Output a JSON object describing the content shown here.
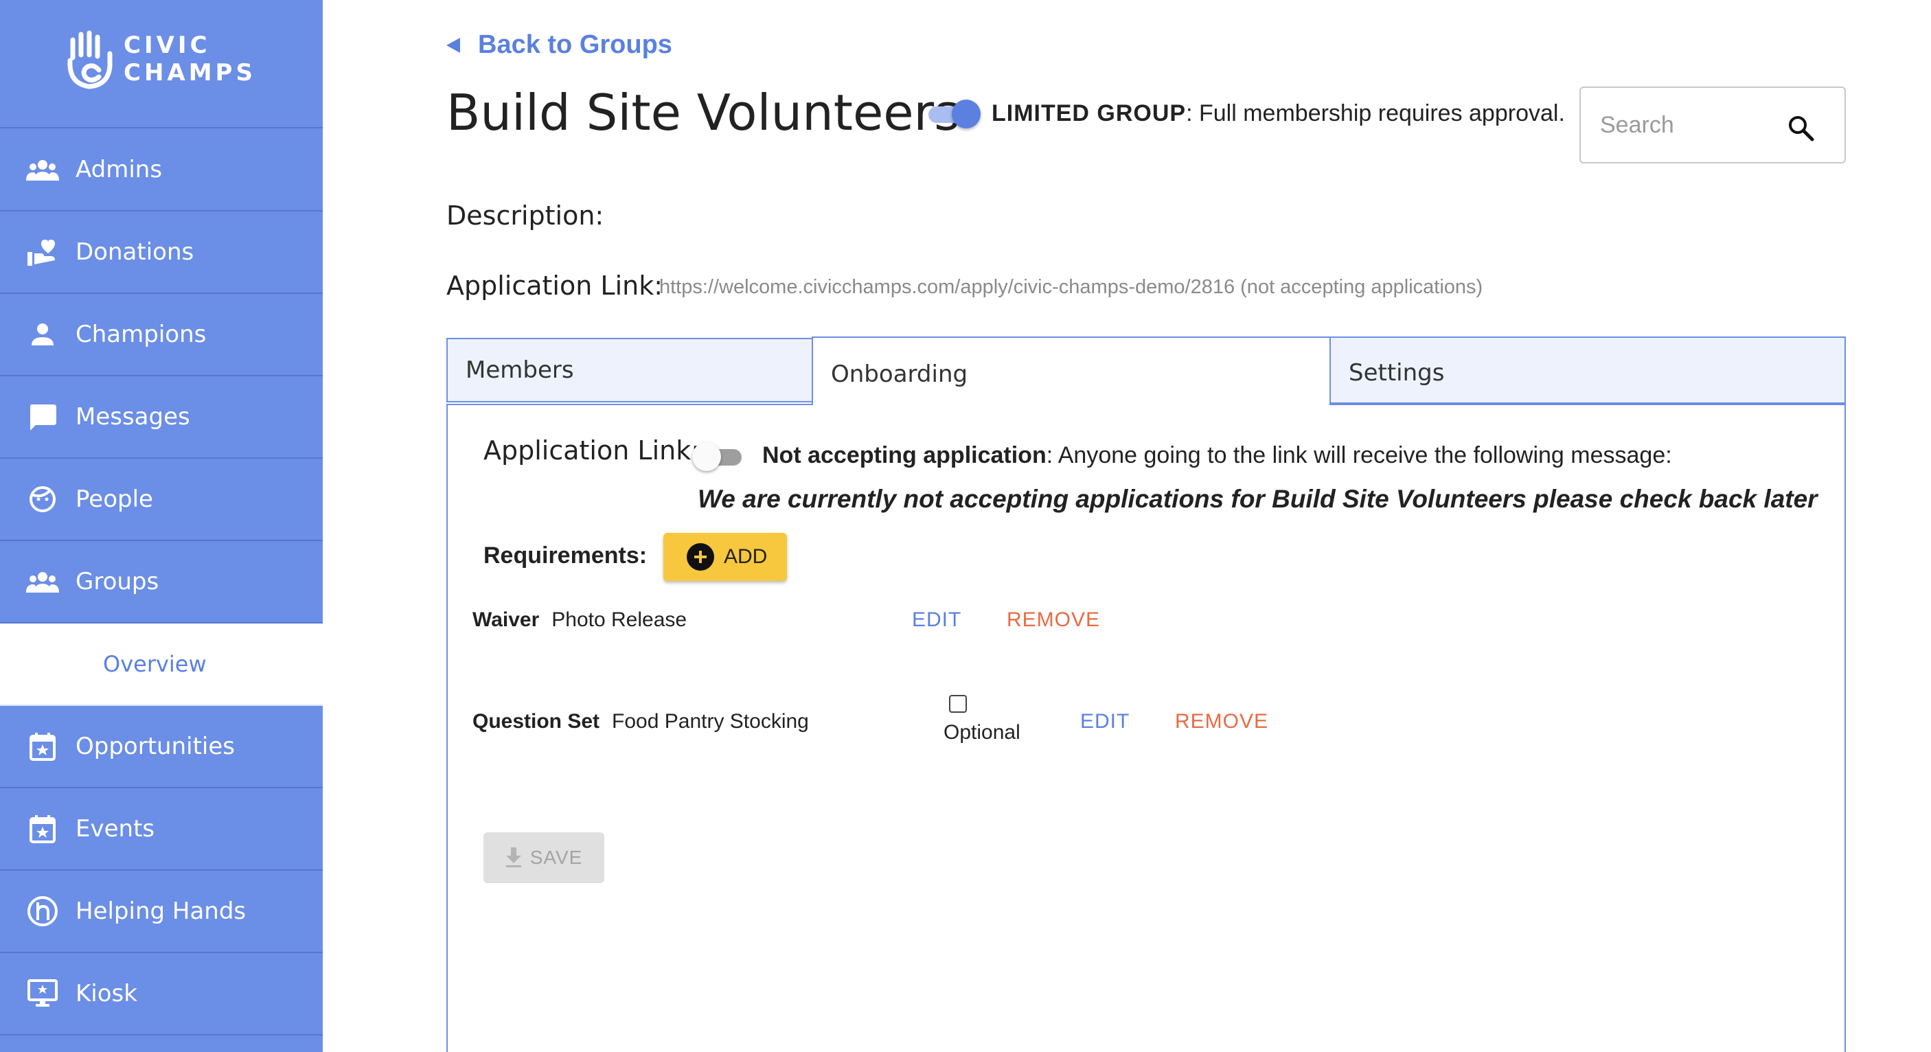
{
  "brand": {
    "line1": "CIVIC",
    "line2": "CHAMPS"
  },
  "sidebar": {
    "items": [
      {
        "label": "Admins",
        "icon": "group-icon"
      },
      {
        "label": "Donations",
        "icon": "donation-hand-heart-icon"
      },
      {
        "label": "Champions",
        "icon": "person-icon"
      },
      {
        "label": "Messages",
        "icon": "chat-bubble-icon"
      },
      {
        "label": "People",
        "icon": "face-icon"
      },
      {
        "label": "Groups",
        "icon": "group-icon"
      },
      {
        "label": "Overview",
        "active": true
      },
      {
        "label": "Opportunities",
        "icon": "calendar-star-icon"
      },
      {
        "label": "Events",
        "icon": "calendar-star-icon"
      },
      {
        "label": "Helping Hands",
        "icon": "helping-hands-logo-icon"
      },
      {
        "label": "Kiosk",
        "icon": "monitor-star-icon"
      }
    ]
  },
  "header": {
    "back_label": "Back to Groups",
    "title": "Build Site Volunteers",
    "limited_group": {
      "enabled": true,
      "bold": "LIMITED GROUP",
      "text": ": Full membership requires approval."
    }
  },
  "search": {
    "placeholder": "Search"
  },
  "details": {
    "description_label": "Description:",
    "application_link_label": "Application Link:",
    "application_link_url": "https://welcome.civicchamps.com/apply/civic-champs-demo/2816 (not accepting applications)"
  },
  "tabs": [
    {
      "label": "Members",
      "active": false
    },
    {
      "label": "Onboarding",
      "active": true
    },
    {
      "label": "Settings",
      "active": false
    }
  ],
  "onboarding": {
    "application_link_label": "Application Link:",
    "accepting": false,
    "status_bold": "Not accepting application",
    "status_text": ": Anyone going to the link will receive the following message:",
    "closed_message": "We are currently not accepting applications for Build Site Volunteers please check back later",
    "requirements_label": "Requirements:",
    "add_label": "ADD",
    "requirements": [
      {
        "type": "Waiver",
        "name": "Photo Release",
        "edit": "EDIT",
        "remove": "REMOVE"
      },
      {
        "type": "Question Set",
        "name": "Food Pantry Stocking",
        "optional_label": "Optional",
        "optional": false,
        "edit": "EDIT",
        "remove": "REMOVE"
      }
    ],
    "save_label": "SAVE"
  },
  "colors": {
    "sidebar": "#6b8ee6",
    "accent": "#5b80e0",
    "add_button": "#f7c73e",
    "remove": "#e96a43"
  }
}
